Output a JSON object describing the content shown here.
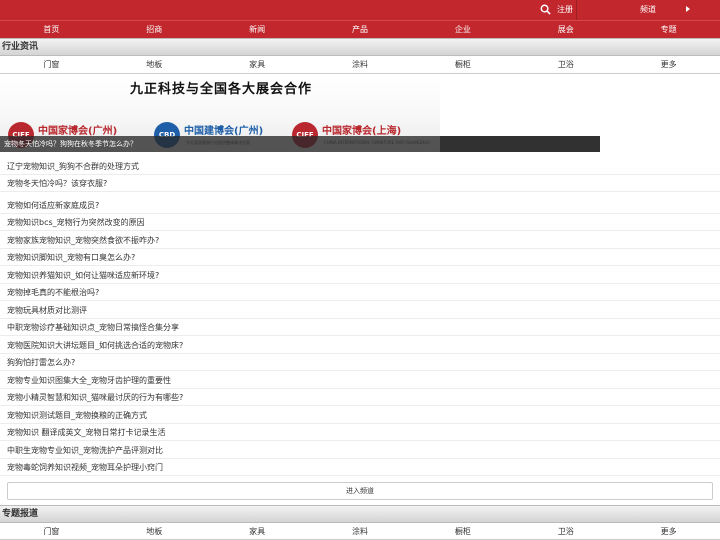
{
  "topbar": {
    "register_label": "注册",
    "channel_label": "频道",
    "icons": [
      "search-icon",
      "arrow-right-icon"
    ]
  },
  "main_nav": [
    "首页",
    "招商",
    "新闻",
    "产品",
    "企业",
    "展会",
    "专题"
  ],
  "section_industry": {
    "title": "行业资讯",
    "subnav": [
      "门窗",
      "地板",
      "家具",
      "涂料",
      "橱柜",
      "卫浴",
      "更多"
    ]
  },
  "banner": {
    "headline": "九正科技与全国各大展会合作",
    "logos": [
      {
        "mark": "CIFF",
        "name": "中国家博会(广州)",
        "sub": ""
      },
      {
        "mark": "CBD",
        "name": "中国建博会(广州)",
        "sub": "为大家居建装行业提供整体解决方案"
      },
      {
        "mark": "CIFF",
        "name": "中国家博会(上海)",
        "sub": "CHINA INTERNATIONAL FURNITURE FAIR (SHANGHAI)"
      }
    ],
    "caption": "宠物冬天怕冷吗？狗狗在秋冬季节怎么办？"
  },
  "articles": [
    "辽宁宠物知识_狗狗不合群的处理方式",
    "宠物冬天怕冷吗？该穿衣服?",
    "宠物如何适应新家庭成员?",
    "宠物知识bcs_宠物行为突然改变的原因",
    "宠物家族宠物知识_宠物突然食欲不振咋办?",
    "宠物知识脚知识_宠物有口臭怎么办?",
    "宠物知识养猫知识_如何让猫咪适应新环境?",
    "宠物掉毛真的不能根治吗?",
    "宠物玩具材质对比测评",
    "中职宠物诊疗基础知识点_宠物日常搞怪合集分享",
    "宠物医院知识大讲坛题目_如何挑选合适的宠物床?",
    "狗狗怕打雷怎么办?",
    "宠物专业知识图集大全_宠物牙齿护理的重要性",
    "宠物小精灵智慧和知识_猫咪最讨厌的行为有哪些?",
    "宠物知识测试题目_宠物换粮的正确方式",
    "宠物知识 翻译成英文_宠物日常打卡记录生活",
    "中职生宠物专业知识_宠物洗护产品评测对比",
    "宠物毒蛇饲养知识视频_宠物耳朵护理小窍门"
  ],
  "more_button": "进入频道",
  "section_special": {
    "title": "专题报道",
    "subnav": [
      "门窗",
      "地板",
      "家具",
      "涂料",
      "橱柜",
      "卫浴",
      "更多"
    ]
  },
  "colors": {
    "brand_red": "#c1272d",
    "ciff_red": "#b8282e",
    "cbd_blue": "#1f5fa8"
  }
}
